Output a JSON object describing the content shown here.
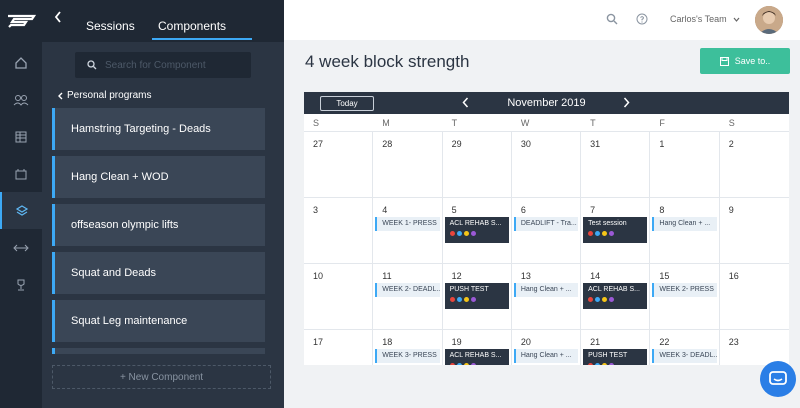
{
  "nav": {
    "items": [
      {
        "name": "home-icon",
        "active": false
      },
      {
        "name": "team-icon",
        "active": false
      },
      {
        "name": "table-icon",
        "active": false
      },
      {
        "name": "calendar-tray-icon",
        "active": false
      },
      {
        "name": "layers-icon",
        "active": true
      },
      {
        "name": "transfer-icon",
        "active": false
      },
      {
        "name": "trophy-icon",
        "active": false
      }
    ]
  },
  "panel": {
    "tabs": {
      "sessions": "Sessions",
      "components": "Components"
    },
    "search_placeholder": "Search for Component",
    "breadcrumb": "Personal programs",
    "items": [
      "Hamstring Targeting - Deads",
      "Hang Clean + WOD",
      "offseason olympic lifts",
      "Squat and Deads",
      "Squat Leg maintenance"
    ],
    "new_component": "+ New Component"
  },
  "header": {
    "team": "Carlos's Team"
  },
  "page": {
    "title": "4 week block strength",
    "save_label": "Save to.."
  },
  "calendar": {
    "today": "Today",
    "month": "November 2019",
    "weekdays": [
      "S",
      "M",
      "T",
      "W",
      "T",
      "F",
      "S"
    ],
    "weeks": [
      [
        {
          "d": "27"
        },
        {
          "d": "28"
        },
        {
          "d": "29"
        },
        {
          "d": "30"
        },
        {
          "d": "31"
        },
        {
          "d": "1"
        },
        {
          "d": "2"
        }
      ],
      [
        {
          "d": "3"
        },
        {
          "d": "4",
          "ev": "WEEK 1- PRESS",
          "t": "light"
        },
        {
          "d": "5",
          "ev": "ACL REHAB S...",
          "t": "dark"
        },
        {
          "d": "6",
          "ev": "DEADLIFT - Tra...",
          "t": "light"
        },
        {
          "d": "7",
          "ev": "Test session",
          "t": "dark"
        },
        {
          "d": "8",
          "ev": "Hang Clean + ...",
          "t": "light"
        },
        {
          "d": "9"
        }
      ],
      [
        {
          "d": "10"
        },
        {
          "d": "11",
          "ev": "WEEK 2- DEADL...",
          "t": "light"
        },
        {
          "d": "12",
          "ev": "PUSH TEST",
          "t": "dark"
        },
        {
          "d": "13",
          "ev": "Hang Clean + ...",
          "t": "light"
        },
        {
          "d": "14",
          "ev": "ACL REHAB S...",
          "t": "dark"
        },
        {
          "d": "15",
          "ev": "WEEK 2- PRESS",
          "t": "light"
        },
        {
          "d": "16"
        }
      ],
      [
        {
          "d": "17"
        },
        {
          "d": "18",
          "ev": "WEEK 3- PRESS",
          "t": "light"
        },
        {
          "d": "19",
          "ev": "ACL REHAB S...",
          "t": "dark"
        },
        {
          "d": "20",
          "ev": "Hang Clean + ...",
          "t": "light"
        },
        {
          "d": "21",
          "ev": "PUSH TEST",
          "t": "dark"
        },
        {
          "d": "22",
          "ev": "WEEK 3- DEADL...",
          "t": "light"
        },
        {
          "d": "23"
        }
      ]
    ],
    "dot_colors": [
      "#e8453c",
      "#3da9f5",
      "#f5c518",
      "#9b59d6"
    ]
  },
  "colors": {
    "accent": "#3da9f5",
    "save": "#3dbf9b",
    "dark": "#2b3543",
    "chat": "#2a7ee6"
  }
}
